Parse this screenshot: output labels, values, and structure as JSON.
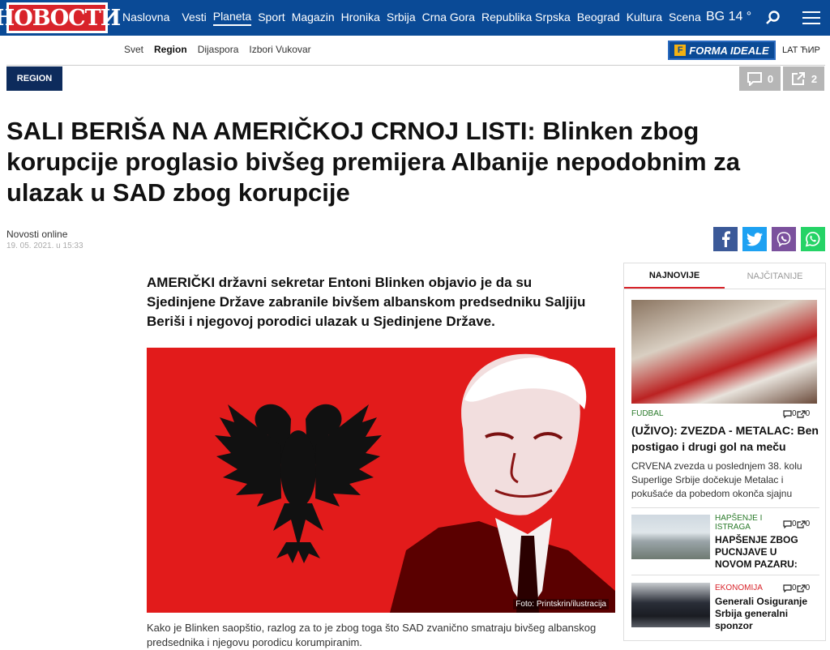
{
  "header": {
    "logo": "НОВОСТИ",
    "nav": [
      "Naslovna",
      "Vesti",
      "Planeta",
      "Sport",
      "Magazin",
      "Hronika",
      "Srbija",
      "Crna Gora",
      "Republika Srpska",
      "Beograd",
      "Kultura",
      "Scena"
    ],
    "active_nav": "Planeta",
    "weather": "BG 14 °"
  },
  "subnav": {
    "items": [
      "Svet",
      "Region",
      "Dijaspora",
      "Izbori Vukovar"
    ],
    "active": "Region",
    "brand": "FORMA IDEALE",
    "lang": "LAT ЋИР"
  },
  "article": {
    "category": "REGION",
    "comments_count": "0",
    "shares_count": "2",
    "title": "SALI BERIŠA NA AMERIČKOJ CRNOJ LISTI: Blinken zbog korupcije proglasio bivšeg premijera Albanije nepodobnim za ulazak u SAD zbog korupcije",
    "author": "Novosti online",
    "date": "19. 05. 2021. u 15:33",
    "lead": "AMERIČKI državni sekretar Entoni Blinken objavio je da su Sjedinjene Države zabranile bivšem albanskom predsedniku Saljiju Beriši i njegovoj porodici ulazak u Sjedinjene Države.",
    "photo_caption": "Foto: Printskrin/ilustracija",
    "body_first": "Kako je Blinken saopštio, razlog za to je zbog toga što SAD zvanično smatraju bivšeg albanskog predsednika i njegovu porodicu korumpiranim."
  },
  "share": {
    "icons": [
      "facebook-icon",
      "twitter-icon",
      "viber-icon",
      "whatsapp-icon"
    ],
    "colors": [
      "#3b5998",
      "#1da1f2",
      "#7b519d",
      "#25d366"
    ]
  },
  "sidebar": {
    "tabs": [
      "NAJNOVIJE",
      "NAJČITANIJE"
    ],
    "featured": {
      "category": "FUDBAL",
      "comments": "0",
      "shares": "0",
      "title": "(UŽIVO): ZVEZDA - METALAC: Ben postigao i drugi gol na meču",
      "desc": "CRVENA zvezda u poslednjem 38. kolu Superlige Srbije dočekuje Metalac i pokušaće da pobedom okonča sjajnu"
    },
    "items": [
      {
        "category": "HAPŠENJE I ISTRAGA",
        "comments": "0",
        "shares": "0",
        "title": "HAPŠENJE ZBOG PUCNJAVE U NOVOM PAZARU:",
        "cat_color": "#2a7a2a"
      },
      {
        "category": "EKONOMIJA",
        "comments": "0",
        "shares": "0",
        "title": "Generali Osiguranje Srbija generalni sponzor",
        "cat_color": "#d8232a"
      }
    ]
  },
  "colors": {
    "brand_blue": "#0a4a96",
    "brand_red": "#d8232a",
    "region_navy": "#0d2b5c",
    "flag_red": "#e21b1b"
  }
}
